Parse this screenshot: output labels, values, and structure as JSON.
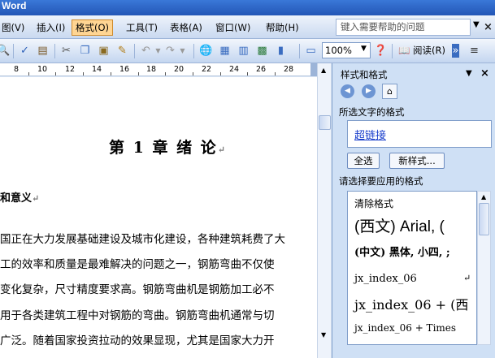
{
  "window": {
    "title": "Word"
  },
  "menubar": {
    "items": [
      "图(V)",
      "插入(I)",
      "格式(O)",
      "工具(T)",
      "表格(A)",
      "窗口(W)",
      "帮助(H)"
    ],
    "active_label": "格式(O)",
    "help_placeholder": "键入需要帮助的问题",
    "close_glyph": "×"
  },
  "toolbar": {
    "zoom_value": "100%",
    "read_label": "阅读(R)"
  },
  "ruler": {
    "numbers": [
      "8",
      "10",
      "12",
      "14",
      "16",
      "18",
      "20",
      "22",
      "24",
      "26",
      "28"
    ]
  },
  "document": {
    "heading": "第 1 章  绪  论",
    "subheading": "和意义",
    "paragraphs": [
      "国正在大力发展基础建设及城市化建设，各种建筑耗费了大",
      "工的效率和质量是最难解决的问题之一，钢筋弯曲不仅使",
      "变化复杂，尺寸精度要求高。钢筋弯曲机是钢筋加工必不",
      "用于各类建筑工程中对钢筋的弯曲。钢筋弯曲机通常与切",
      "广泛。随着国家投资拉动的效果显现，尤其是国家大力开"
    ],
    "paragraph_mark": "↵"
  },
  "task_pane": {
    "title": "样式和格式",
    "selected_format_label": "所选文字的格式",
    "selected_format_value": "超链接",
    "select_all_label": "全选",
    "new_style_label": "新样式...",
    "apply_label": "请选择要应用的格式",
    "formats": [
      "清除格式",
      "(西文) Arial, (",
      "(中文) 黑体, 小四, ;",
      "jx_index_06",
      "jx_index_06 + (西",
      "jx_index_06 + Times"
    ]
  }
}
